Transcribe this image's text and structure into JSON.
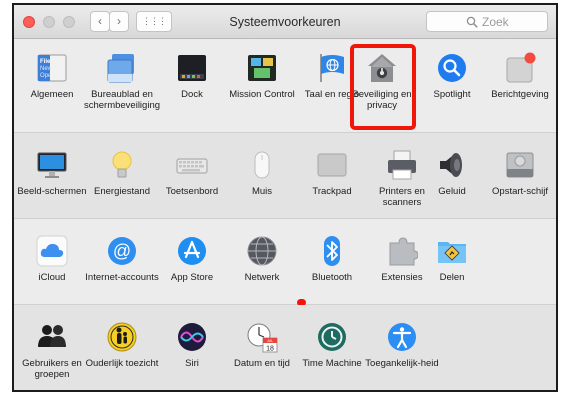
{
  "window": {
    "title": "Systeemvoorkeuren"
  },
  "toolbar": {
    "back_glyph": "‹",
    "forward_glyph": "›",
    "grid_glyph": "⋮⋮⋮"
  },
  "search": {
    "placeholder": "Zoek"
  },
  "colors": {
    "highlight": "#f0160a",
    "accent_blue": "#1e7cf0"
  },
  "rows": [
    {
      "items": [
        {
          "label": "Algemeen",
          "icon": "general-icon"
        },
        {
          "label": "Bureaublad en schermbeveiliging",
          "icon": "desktop-screensaver-icon"
        },
        {
          "label": "Dock",
          "icon": "dock-icon"
        },
        {
          "label": "Mission Control",
          "icon": "mission-control-icon"
        },
        {
          "label": "Taal en regio",
          "icon": "language-region-icon"
        },
        {
          "label": "Beveiliging en privacy",
          "icon": "security-privacy-icon"
        },
        {
          "label": "Spotlight",
          "icon": "spotlight-icon"
        },
        {
          "label": "Berichtgeving",
          "icon": "notifications-icon"
        }
      ]
    },
    {
      "items": [
        {
          "label": "Beeld-schermen",
          "icon": "displays-icon"
        },
        {
          "label": "Energiestand",
          "icon": "energy-saver-icon"
        },
        {
          "label": "Toetsenbord",
          "icon": "keyboard-icon"
        },
        {
          "label": "Muis",
          "icon": "mouse-icon"
        },
        {
          "label": "Trackpad",
          "icon": "trackpad-icon"
        },
        {
          "label": "Printers en scanners",
          "icon": "printers-scanners-icon"
        },
        {
          "label": "Geluid",
          "icon": "sound-icon"
        },
        {
          "label": "Opstart-schijf",
          "icon": "startup-disk-icon"
        }
      ]
    },
    {
      "items": [
        {
          "label": "iCloud",
          "icon": "icloud-icon"
        },
        {
          "label": "Internet-accounts",
          "icon": "internet-accounts-icon"
        },
        {
          "label": "App Store",
          "icon": "app-store-icon"
        },
        {
          "label": "Netwerk",
          "icon": "network-icon"
        },
        {
          "label": "Bluetooth",
          "icon": "bluetooth-icon"
        },
        {
          "label": "Extensies",
          "icon": "extensions-icon"
        },
        {
          "label": "Delen",
          "icon": "sharing-icon"
        }
      ]
    },
    {
      "items": [
        {
          "label": "Gebruikers en groepen",
          "icon": "users-groups-icon"
        },
        {
          "label": "Ouderlijk toezicht",
          "icon": "parental-controls-icon"
        },
        {
          "label": "Siri",
          "icon": "siri-icon"
        },
        {
          "label": "Datum en tijd",
          "icon": "date-time-icon"
        },
        {
          "label": "Time Machine",
          "icon": "time-machine-icon"
        },
        {
          "label": "Toegankelijk-heid",
          "icon": "accessibility-icon"
        }
      ]
    }
  ],
  "calendar_icon": {
    "month": "JUL",
    "day": "18"
  },
  "general_icon_text": {
    "line1": "File",
    "line2": "New",
    "line3": "Ope"
  }
}
